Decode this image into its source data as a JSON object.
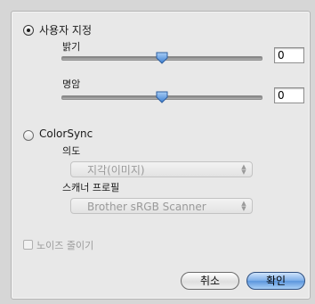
{
  "custom": {
    "radio_label": "사용자 지정",
    "brightness": {
      "label": "밝기",
      "value": "0",
      "level_fraction": 0.5
    },
    "contrast": {
      "label": "명암",
      "value": "0",
      "level_fraction": 0.5
    }
  },
  "colorsync": {
    "radio_label": "ColorSync",
    "intent": {
      "label": "의도",
      "selected": "지각(이미지)"
    },
    "scanner_profile": {
      "label": "스캐너 프로필",
      "selected": "Brother sRGB Scanner"
    }
  },
  "noise_reduction": {
    "label": "노이즈 줄이기",
    "checked": false
  },
  "buttons": {
    "cancel": "취소",
    "ok": "확인"
  },
  "colors": {
    "default_button": "#6aa3e6",
    "accent_thumb": "#4a86d6"
  }
}
